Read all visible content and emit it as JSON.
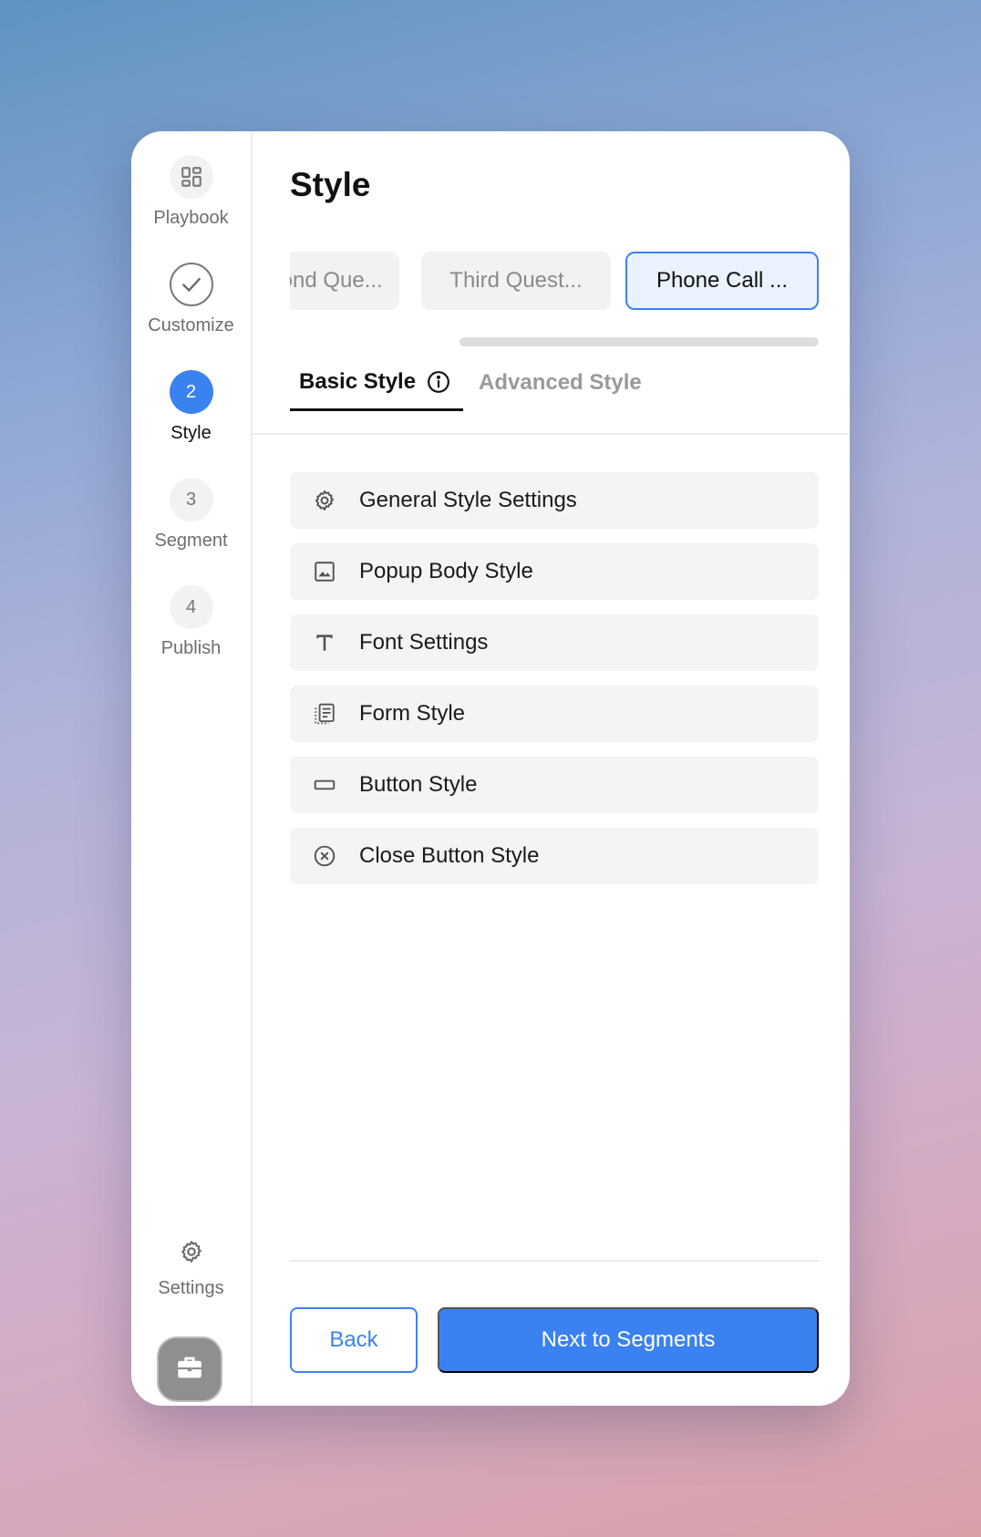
{
  "sidebar": {
    "steps": [
      {
        "label": "Playbook",
        "icon": "dashboard-icon"
      },
      {
        "label": "Customize",
        "icon": "check-icon"
      },
      {
        "label": "Style",
        "number": "2",
        "state": "active"
      },
      {
        "label": "Segment",
        "number": "3"
      },
      {
        "label": "Publish",
        "number": "4"
      }
    ],
    "settings_label": "Settings",
    "briefcase_icon": "briefcase-icon"
  },
  "main": {
    "title": "Style",
    "question_tabs": [
      {
        "label": "Second Que..."
      },
      {
        "label": "Third Quest..."
      },
      {
        "label": "Phone Call ..."
      }
    ],
    "style_tabs": {
      "basic": "Basic Style",
      "advanced": "Advanced Style"
    },
    "menu_items": [
      {
        "label": "General Style Settings",
        "icon": "gear-icon"
      },
      {
        "label": "Popup Body Style",
        "icon": "image-icon"
      },
      {
        "label": "Font Settings",
        "icon": "text-icon"
      },
      {
        "label": "Form Style",
        "icon": "form-icon"
      },
      {
        "label": "Button Style",
        "icon": "button-icon"
      },
      {
        "label": "Close Button Style",
        "icon": "close-circle-icon"
      }
    ],
    "back_label": "Back",
    "next_label": "Next to Segments"
  },
  "colors": {
    "accent": "#3b82f0",
    "active_tab_bg": "#eaf2ff",
    "menu_item_bg": "#f4f4f4"
  }
}
